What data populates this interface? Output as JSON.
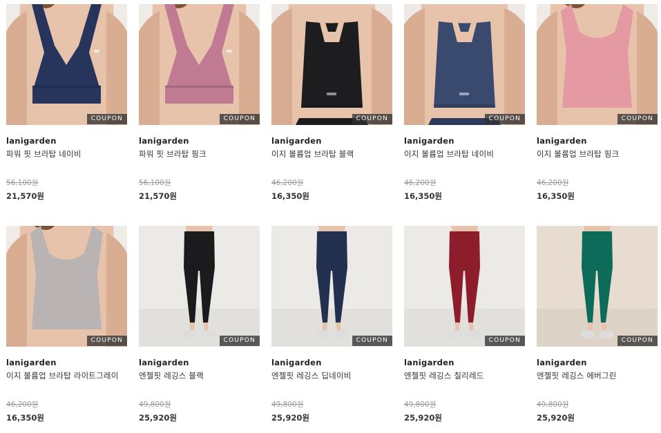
{
  "coupon_label": "COUPON",
  "products": [
    {
      "brand": "lanigarden",
      "name": "파워 핏 브라탑 네이비",
      "original_price": "56,100원",
      "sale_price": "21,570원",
      "image": "navy-sports-bra",
      "garment_color": "#27355c",
      "bg_color": "#efebe7"
    },
    {
      "brand": "lanigarden",
      "name": "파워 핏 브라탑 핑크",
      "original_price": "56,100원",
      "sale_price": "21,570원",
      "image": "pink-sports-bra",
      "garment_color": "#c07a91",
      "bg_color": "#efebe7"
    },
    {
      "brand": "lanigarden",
      "name": "이지 볼륨업 브라탑 블랙",
      "original_price": "46,200원",
      "sale_price": "16,350원",
      "image": "black-bra-top-back",
      "garment_color": "#1d1d1f",
      "bg_color": "#ece9e6"
    },
    {
      "brand": "lanigarden",
      "name": "이지 볼륨업 브라탑 네이비",
      "original_price": "46,200원",
      "sale_price": "16,350원",
      "image": "navy-bra-top-back",
      "garment_color": "#3a4a6e",
      "bg_color": "#ece9e6"
    },
    {
      "brand": "lanigarden",
      "name": "이지 볼륨업 브라탑 핑크",
      "original_price": "46,200원",
      "sale_price": "16,350원",
      "image": "pink-bra-top",
      "garment_color": "#e59aa3",
      "bg_color": "#efebe7"
    },
    {
      "brand": "lanigarden",
      "name": "이지 볼륨업 브라탑 라이트그레이",
      "original_price": "46,200원",
      "sale_price": "16,350원",
      "image": "grey-bra-top",
      "garment_color": "#b9b3b4",
      "bg_color": "#efebe7"
    },
    {
      "brand": "lanigarden",
      "name": "엔젤핏 레깅스 블랙",
      "original_price": "49,800원",
      "sale_price": "25,920원",
      "image": "black-leggings",
      "garment_color": "#1b1b1d",
      "bg_color": "#eceae7"
    },
    {
      "brand": "lanigarden",
      "name": "엔젤핏 레깅스 딥네이비",
      "original_price": "49,800원",
      "sale_price": "25,920원",
      "image": "navy-leggings",
      "garment_color": "#23304f",
      "bg_color": "#eceae7"
    },
    {
      "brand": "lanigarden",
      "name": "엔젤핏 레깅스 칠리레드",
      "original_price": "49,800원",
      "sale_price": "25,920원",
      "image": "red-leggings",
      "garment_color": "#8e1d2c",
      "bg_color": "#eceae7"
    },
    {
      "brand": "lanigarden",
      "name": "엔젤핏 레깅스 에버그린",
      "original_price": "49,800원",
      "sale_price": "25,920원",
      "image": "green-leggings",
      "garment_color": "#0d6b5a",
      "bg_color": "#e7dccf"
    }
  ]
}
